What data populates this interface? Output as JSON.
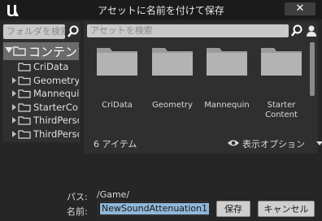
{
  "window": {
    "title": "アセットに名前を付けて保存",
    "close_label": "✕"
  },
  "folder_panel": {
    "search_placeholder": "フォルダを検索",
    "root": {
      "label": "コンテンツ"
    },
    "items": [
      {
        "label": "CriData",
        "has_children": false
      },
      {
        "label": "Geometry",
        "has_children": true
      },
      {
        "label": "Mannequin",
        "has_children": true
      },
      {
        "label": "StarterContent",
        "has_children": true
      },
      {
        "label": "ThirdPerson",
        "has_children": true
      },
      {
        "label": "ThirdPersonBP",
        "has_children": true
      }
    ]
  },
  "asset_panel": {
    "search_placeholder": "アセットを検索",
    "assets": [
      {
        "label": "CriData"
      },
      {
        "label": "Geometry"
      },
      {
        "label": "Mannequin"
      },
      {
        "label": "Starter\nContent"
      }
    ],
    "item_count": "6 アイテム",
    "view_options_label": "表示オプション"
  },
  "footer": {
    "path_label": "パス:",
    "path_value": "/Game/",
    "name_label": "名前:",
    "name_value": "NewSoundAttenuation1",
    "save_label": "保存",
    "cancel_label": "キャンセル"
  }
}
